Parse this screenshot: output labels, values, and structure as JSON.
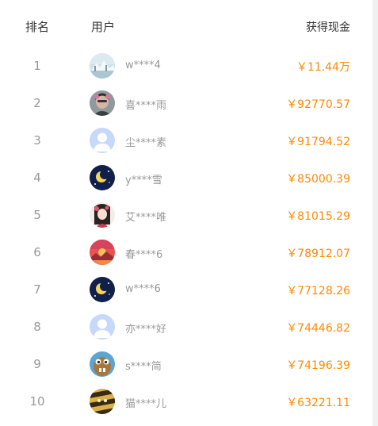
{
  "header": {
    "rank": "排名",
    "user": "用户",
    "cash": "获得现金"
  },
  "rows": [
    {
      "rank": "1",
      "user": "w****4",
      "cash": "￥11.44万",
      "avatar": "snowy-landscape-avatar"
    },
    {
      "rank": "2",
      "user": "喜****雨",
      "cash": "￥92770.57",
      "avatar": "person-photo-avatar"
    },
    {
      "rank": "3",
      "user": "尘****素",
      "cash": "￥91794.52",
      "avatar": "default-user-avatar"
    },
    {
      "rank": "4",
      "user": "y****雪",
      "cash": "￥85000.39",
      "avatar": "moon-night-avatar"
    },
    {
      "rank": "5",
      "user": "艾****唯",
      "cash": "￥81015.29",
      "avatar": "illustrated-girl-avatar"
    },
    {
      "rank": "6",
      "user": "春****6",
      "cash": "￥78912.07",
      "avatar": "sunset-landscape-avatar"
    },
    {
      "rank": "7",
      "user": "w****6",
      "cash": "￥77128.26",
      "avatar": "moon-night-avatar"
    },
    {
      "rank": "8",
      "user": "亦****好",
      "cash": "￥74446.82",
      "avatar": "default-user-avatar"
    },
    {
      "rank": "9",
      "user": "s****简",
      "cash": "￥74196.39",
      "avatar": "cartoon-character-avatar"
    },
    {
      "rank": "10",
      "user": "猫****儿",
      "cash": "￥63221.11",
      "avatar": "bee-pattern-avatar"
    }
  ],
  "colors": {
    "header_text": "#333333",
    "rank_text": "#999999",
    "user_text": "#999999",
    "cash_text": "#ff8a00"
  }
}
